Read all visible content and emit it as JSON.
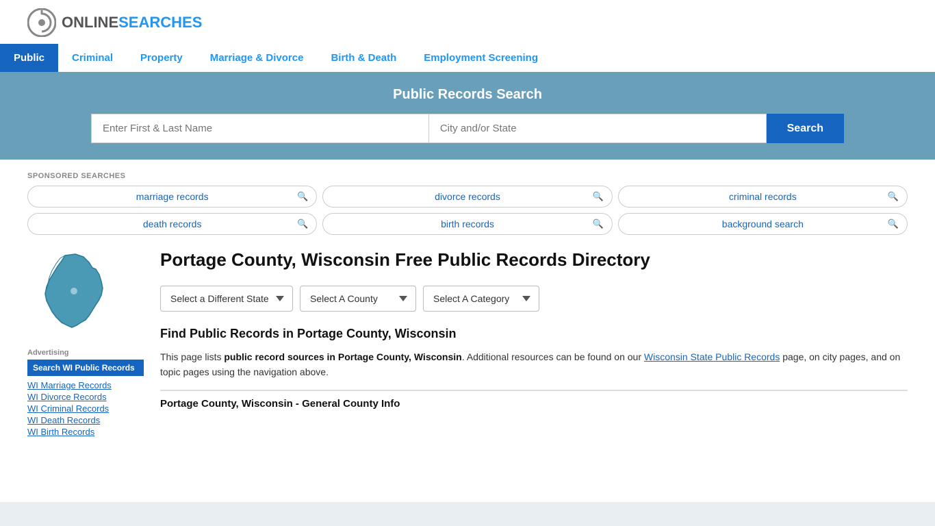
{
  "site": {
    "logo_online": "ONLINE",
    "logo_searches": "SEARCHES"
  },
  "nav": {
    "items": [
      {
        "label": "Public",
        "active": true
      },
      {
        "label": "Criminal",
        "active": false
      },
      {
        "label": "Property",
        "active": false
      },
      {
        "label": "Marriage & Divorce",
        "active": false
      },
      {
        "label": "Birth & Death",
        "active": false
      },
      {
        "label": "Employment Screening",
        "active": false
      }
    ]
  },
  "search_banner": {
    "title": "Public Records Search",
    "name_placeholder": "Enter First & Last Name",
    "location_placeholder": "City and/or State",
    "button_label": "Search"
  },
  "sponsored": {
    "label": "SPONSORED SEARCHES",
    "pills": [
      "marriage records",
      "divorce records",
      "criminal records",
      "death records",
      "birth records",
      "background search"
    ]
  },
  "sidebar": {
    "advertising_label": "Advertising",
    "ad_button": "Search WI Public Records",
    "links": [
      "WI Marriage Records",
      "WI Divorce Records",
      "WI Criminal Records",
      "WI Death Records",
      "WI Birth Records"
    ]
  },
  "article": {
    "title": "Portage County, Wisconsin Free Public Records Directory",
    "state_dropdown": "Select a Different State",
    "county_dropdown": "Select A County",
    "category_dropdown": "Select A Category",
    "find_title": "Find Public Records in Portage County, Wisconsin",
    "body_text": "This page lists ",
    "body_bold1": "public record sources in Portage County, Wisconsin",
    "body_text2": ". Additional resources can be found on our ",
    "body_link": "Wisconsin State Public Records",
    "body_text3": " page, on city pages, and on topic pages using the navigation above.",
    "section_title": "Portage County, Wisconsin - General County Info"
  }
}
